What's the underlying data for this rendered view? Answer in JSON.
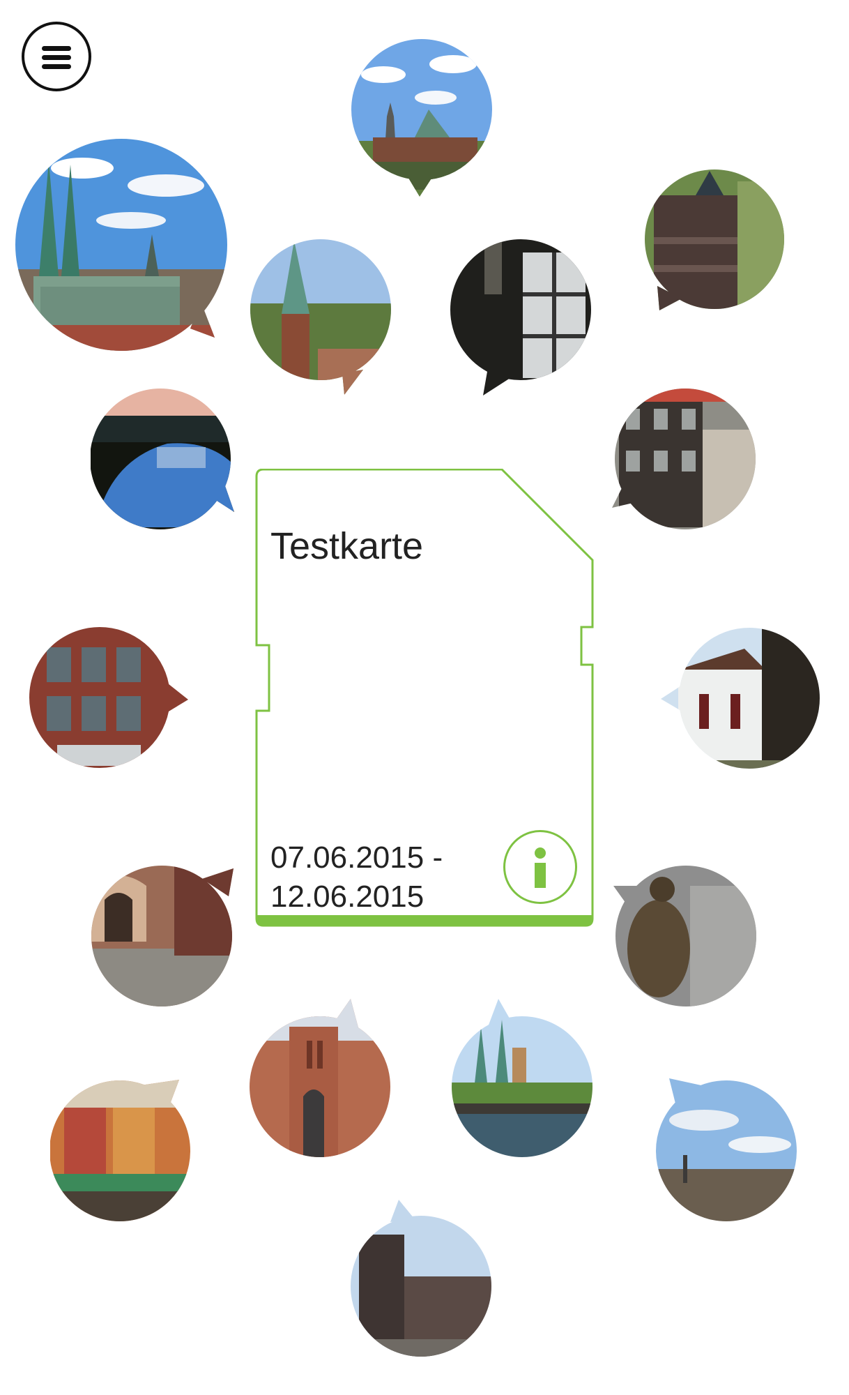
{
  "card": {
    "title": "Testkarte",
    "date_start": "07.06.2015 -",
    "date_end": "12.06.2015"
  },
  "colors": {
    "accent": "#7ec242",
    "text": "#222222",
    "menu_icon": "#111111"
  },
  "icons": {
    "menu": "hamburger-menu-icon",
    "info": "info-icon"
  },
  "photos": [
    {
      "scene": "church-spires-blue-sky"
    },
    {
      "scene": "cathedral-panorama"
    },
    {
      "scene": "holstentor-gate-aerial"
    },
    {
      "scene": "church-tower-over-city"
    },
    {
      "scene": "dark-window-interior"
    },
    {
      "scene": "car-at-sunset"
    },
    {
      "scene": "town-hall-facade"
    },
    {
      "scene": "brick-building-windows"
    },
    {
      "scene": "white-chapel"
    },
    {
      "scene": "arcade-walkway"
    },
    {
      "scene": "bronze-statue"
    },
    {
      "scene": "red-brick-church"
    },
    {
      "scene": "river-bridge-spires"
    },
    {
      "scene": "colorful-market-street"
    },
    {
      "scene": "harbor-sky"
    },
    {
      "scene": "gothic-gate-street"
    }
  ]
}
